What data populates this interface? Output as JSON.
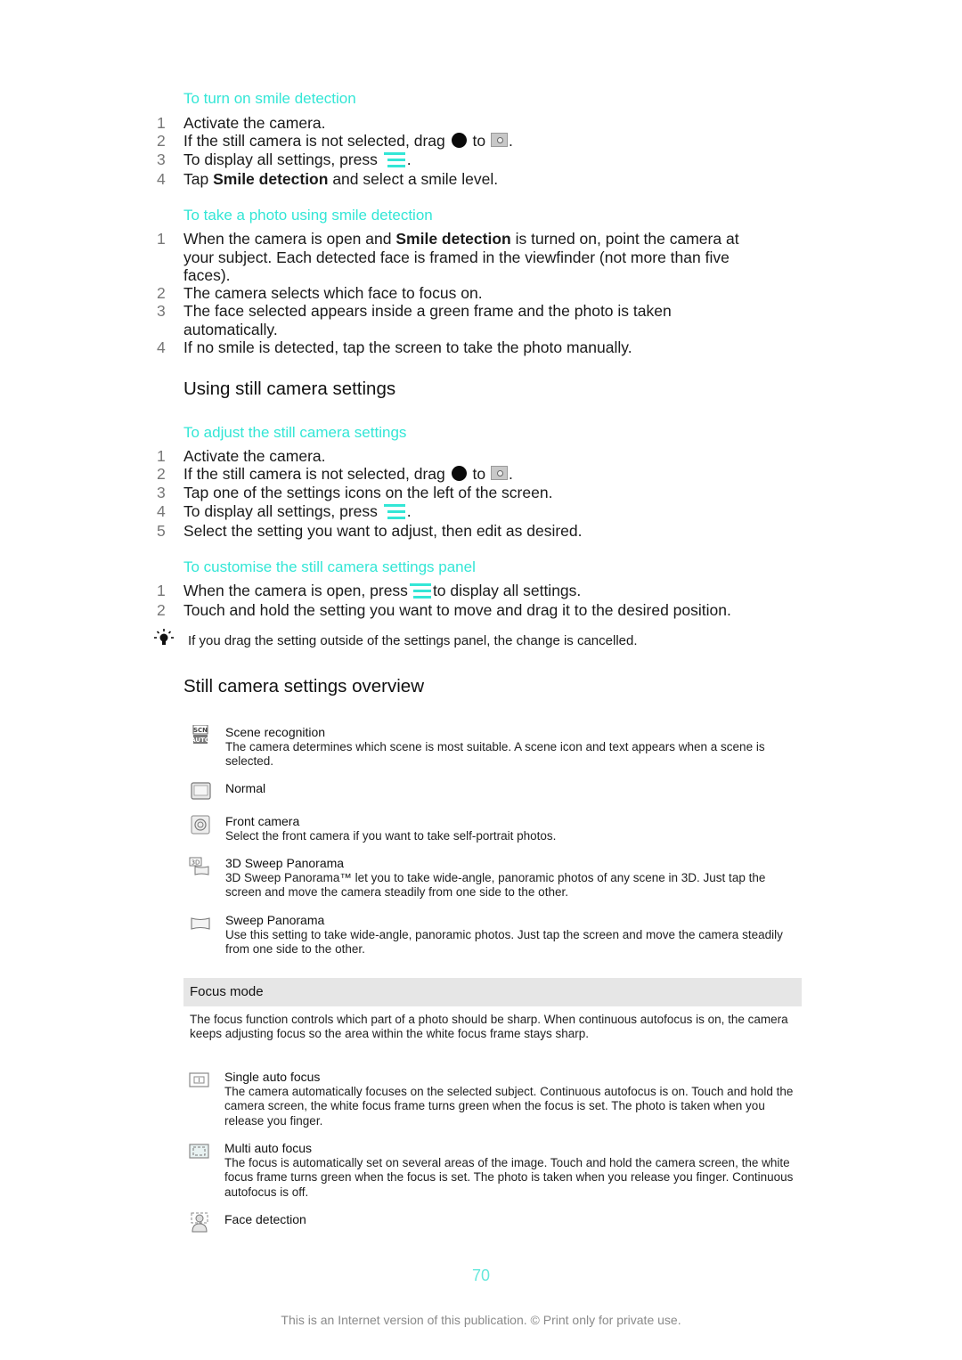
{
  "section_smile_on": {
    "heading": "To turn on smile detection",
    "steps": [
      {
        "num": "1",
        "text": "Activate the camera."
      },
      {
        "num": "2",
        "pre": "If the still camera is not selected, drag",
        "mid": "to",
        "post": "."
      },
      {
        "num": "3",
        "pre": "To display all settings, press",
        "post": "."
      },
      {
        "num": "4",
        "pre": "Tap",
        "bold": "Smile detection",
        "post": "and select a smile level."
      }
    ]
  },
  "section_smile_photo": {
    "heading": "To take a photo using smile detection",
    "steps": [
      {
        "num": "1",
        "pre": "When the camera is open and",
        "bold": "Smile detection",
        "post": "is turned on, point the camera at your subject. Each detected face is framed in the viewfinder (not more than five faces)."
      },
      {
        "num": "2",
        "text": "The camera selects which face to focus on."
      },
      {
        "num": "3",
        "text": "The face selected appears inside a green frame and the photo is taken automatically."
      },
      {
        "num": "4",
        "text": "If no smile is detected, tap the screen to take the photo manually."
      }
    ]
  },
  "heading_using": "Using still camera settings",
  "section_adjust": {
    "heading": "To adjust the still camera settings",
    "steps": [
      {
        "num": "1",
        "text": "Activate the camera."
      },
      {
        "num": "2",
        "pre": "If the still camera is not selected, drag",
        "mid": "to",
        "post": "."
      },
      {
        "num": "3",
        "text": "Tap one of the settings icons on the left of the screen."
      },
      {
        "num": "4",
        "pre": "To display all settings, press",
        "post": "."
      },
      {
        "num": "5",
        "text": "Select the setting you want to adjust, then edit as desired."
      }
    ]
  },
  "section_customise": {
    "heading": "To customise the still camera settings panel",
    "steps": [
      {
        "num": "1",
        "pre": "When the camera is open, press",
        "post": "to display all settings."
      },
      {
        "num": "2",
        "text": "Touch and hold the setting you want to move and drag it to the desired position."
      }
    ]
  },
  "tip": "If you drag the setting outside of the settings panel, the change is cancelled.",
  "heading_overview": "Still camera settings overview",
  "scene_settings": [
    {
      "icon": "scene-recognition-icon",
      "title": "Scene recognition",
      "desc": "The camera determines which scene is most suitable. A scene icon and text appears when a scene is selected."
    },
    {
      "icon": "normal-icon",
      "title": "Normal",
      "desc": ""
    },
    {
      "icon": "front-camera-icon",
      "title": "Front camera",
      "desc": "Select the front camera if you want to take self-portrait photos."
    },
    {
      "icon": "3d-sweep-panorama-icon",
      "title": "3D Sweep Panorama",
      "desc": "3D Sweep Panorama™ let you to take wide-angle, panoramic photos of any scene in 3D. Just tap the screen and move the camera steadily from one side to the other."
    },
    {
      "icon": "sweep-panorama-icon",
      "title": "Sweep Panorama",
      "desc": "Use this setting to take wide-angle, panoramic photos. Just tap the screen and move the camera steadily from one side to the other."
    }
  ],
  "focus_mode": {
    "title": "Focus mode",
    "desc": "The focus function controls which part of a photo should be sharp. When continuous autofocus is on, the camera keeps adjusting focus so the area within the white focus frame stays sharp.",
    "items": [
      {
        "icon": "single-auto-focus-icon",
        "title": "Single auto focus",
        "desc": "The camera automatically focuses on the selected subject. Continuous autofocus is on. Touch and hold the camera screen, the white focus frame turns green when the focus is set. The photo is taken when you release you finger."
      },
      {
        "icon": "multi-auto-focus-icon",
        "title": "Multi auto focus",
        "desc": "The focus is automatically set on several areas of the image. Touch and hold the camera screen, the white focus frame turns green when the focus is set. The photo is taken when you release you finger. Continuous autofocus is off."
      },
      {
        "icon": "face-detection-icon",
        "title": "Face detection",
        "desc": ""
      }
    ]
  },
  "page_number": "70",
  "footer": "This is an Internet version of this publication. © Print only for private use.",
  "colors": {
    "accent": "#33e6d6",
    "step_number": "#777777",
    "focus_bar": "#e6e6e6"
  }
}
